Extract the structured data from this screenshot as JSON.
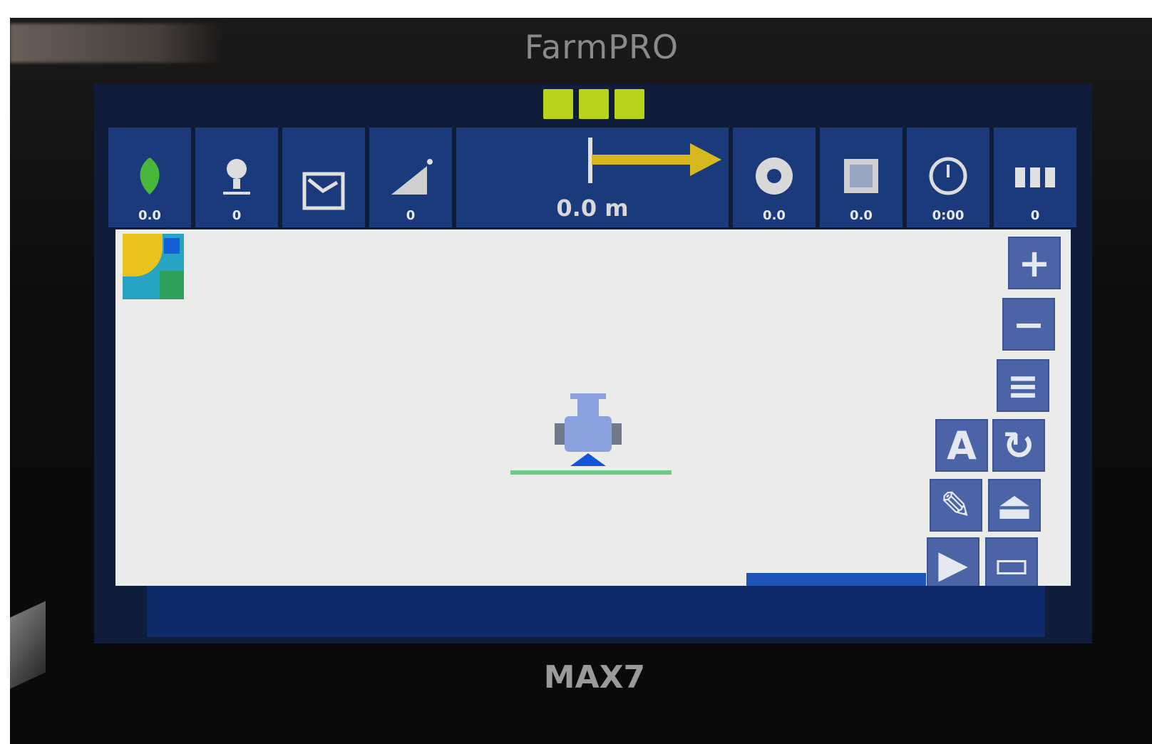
{
  "device": {
    "brand_top": "FarmPRO",
    "model": "MAX7"
  },
  "status_lights": [
    {
      "color": "#b9d21a"
    },
    {
      "color": "#b9d21a"
    },
    {
      "color": "#b9d21a"
    }
  ],
  "top_tiles_left": [
    {
      "icon": "leaf-icon",
      "value": "0.0"
    },
    {
      "icon": "person-pin-icon",
      "value": "0"
    },
    {
      "icon": "field-boundary-icon",
      "value": ""
    },
    {
      "icon": "slope-icon",
      "value": "0"
    }
  ],
  "guidance": {
    "distance": "0.0 m",
    "arrow_color": "#d6b81e"
  },
  "top_tiles_right": [
    {
      "icon": "speedometer-icon",
      "value": "0.0"
    },
    {
      "icon": "area-icon",
      "value": "0.0"
    },
    {
      "icon": "timer-icon",
      "value": "0:00"
    },
    {
      "icon": "sections-icon",
      "value": "0"
    }
  ],
  "map": {
    "timestamp": "",
    "status_strip": ""
  },
  "side_buttons": [
    {
      "name": "zoom-in-button",
      "label": "+"
    },
    {
      "name": "zoom-out-button",
      "label": "−"
    },
    {
      "name": "menu-button",
      "label": "≡"
    },
    {
      "name": "auto-steer-button",
      "label": "A"
    },
    {
      "name": "rotate-view-button",
      "label": "↻"
    },
    {
      "name": "edit-line-button",
      "label": "✎"
    },
    {
      "name": "operator-button",
      "label": "⏏"
    },
    {
      "name": "play-button",
      "label": "▶"
    },
    {
      "name": "record-button",
      "label": "▭"
    }
  ],
  "bottom_bar": {
    "line1": "",
    "line2": ""
  },
  "colors": {
    "screen_bg": "#0f1d3a",
    "tile_bg": "#1b3a7c",
    "map_bg": "#ebebe9",
    "button_bg": "#4b64a8"
  }
}
